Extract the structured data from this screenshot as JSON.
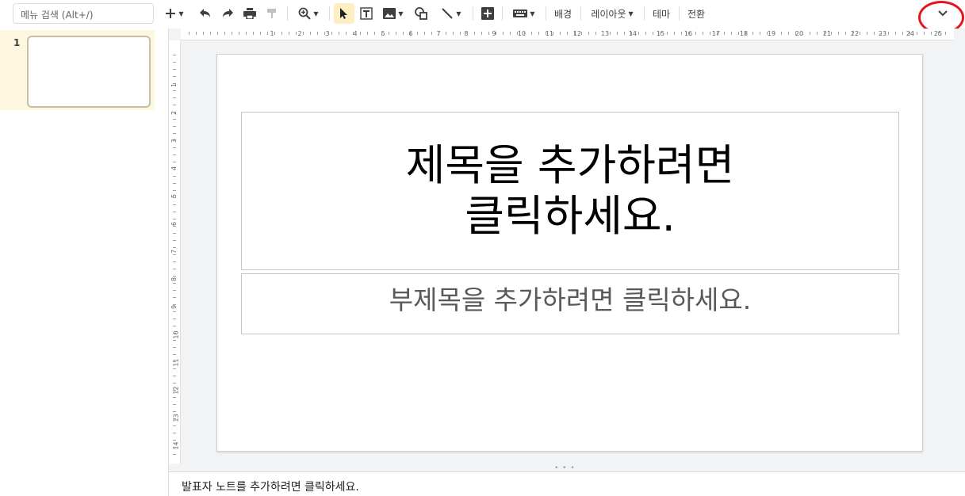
{
  "toolbar": {
    "search_placeholder": "메뉴 검색 (Alt+/)",
    "background_label": "배경",
    "layout_label": "레이아웃",
    "theme_label": "테마",
    "transition_label": "전환",
    "icons": [
      "plus-icon",
      "undo-icon",
      "redo-icon",
      "print-icon",
      "paint-format-icon",
      "zoom-icon",
      "select-icon",
      "textbox-icon",
      "image-icon",
      "shape-icon",
      "line-icon",
      "comment-icon",
      "keyboard-icon",
      "chevron-down-icon"
    ]
  },
  "filmstrip": {
    "slides": [
      {
        "number": "1"
      }
    ]
  },
  "rulers": {
    "horizontal": [
      "1",
      "2",
      "3",
      "4",
      "5",
      "6",
      "7",
      "8",
      "9",
      "10",
      "11",
      "12",
      "13",
      "14",
      "15",
      "16",
      "17",
      "18",
      "19",
      "20",
      "21",
      "22",
      "23",
      "24",
      "25"
    ],
    "vertical": [
      "1",
      "2",
      "3",
      "4",
      "5",
      "6",
      "7",
      "8",
      "9",
      "10",
      "11",
      "12",
      "13",
      "14"
    ]
  },
  "slide": {
    "title_placeholder": "제목을 추가하려면\n클릭하세요.",
    "subtitle_placeholder": "부제목을 추가하려면 클릭하세요."
  },
  "notes": {
    "placeholder": "발표자 노트를 추가하려면 클릭하세요."
  },
  "colors": {
    "highlight": "#e8141c",
    "selected_slide_bg": "#fef7e0",
    "active_tool_bg": "#feefc3"
  }
}
